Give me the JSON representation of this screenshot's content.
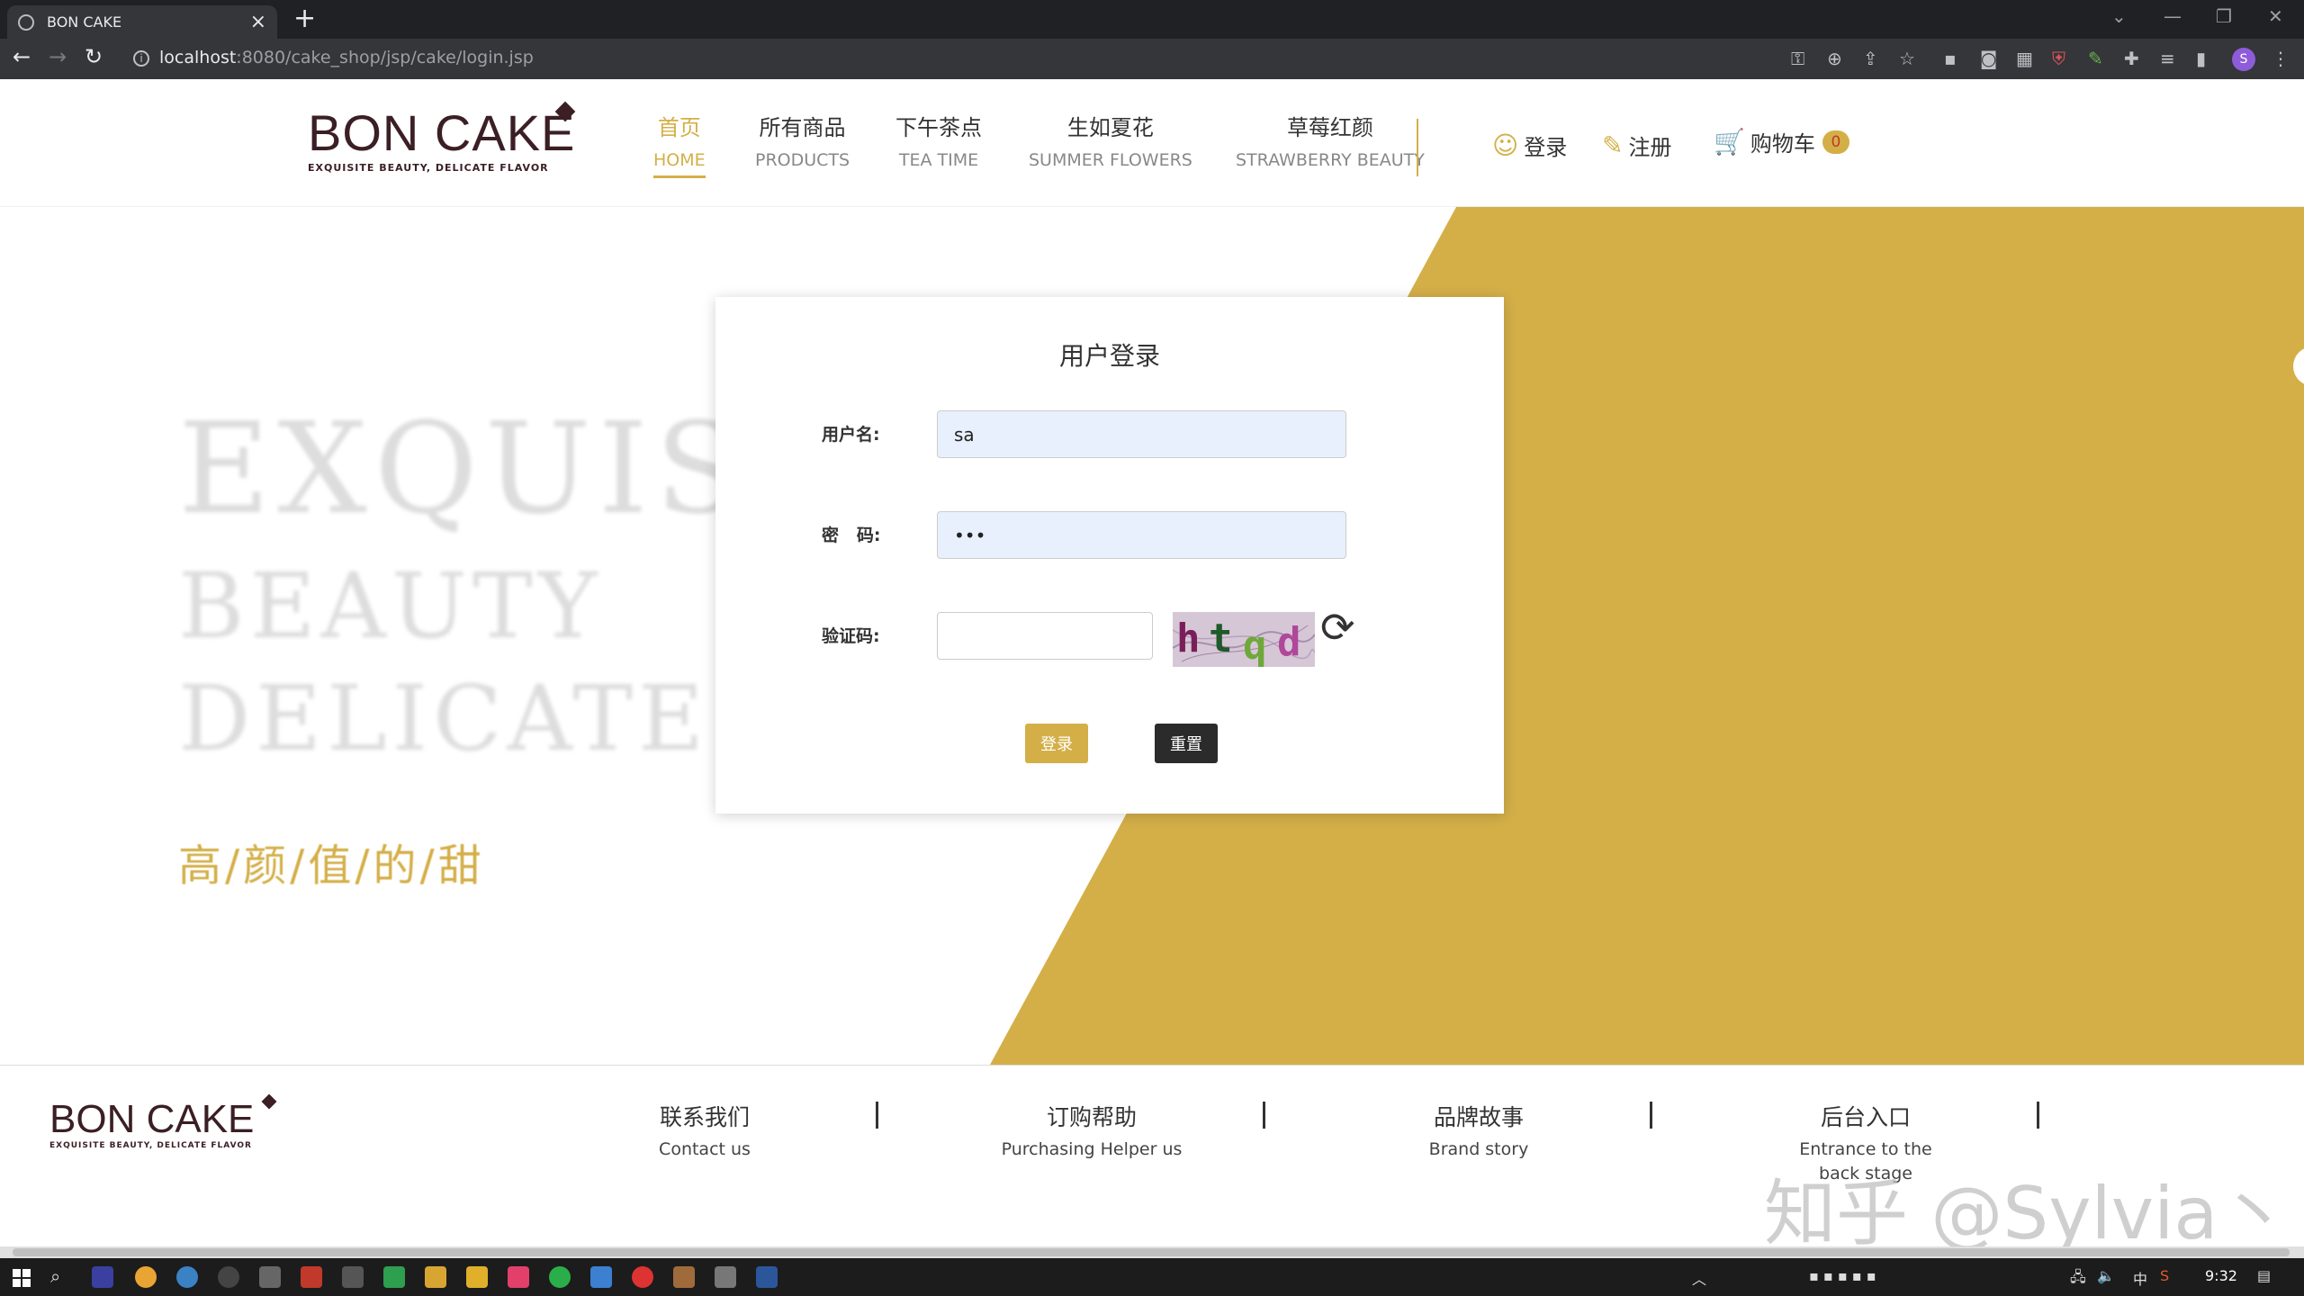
{
  "browser": {
    "tab_title": "BON CAKE",
    "tab_close": "×",
    "new_tab": "+",
    "url_host": "localhost",
    "url_path": ":8080/cake_shop/jsp/cake/login.jsp",
    "profile_initial": "S",
    "win_minimize": "—",
    "win_restore": "❐",
    "win_close": "✕",
    "win_tabsearch": "⌄"
  },
  "site": {
    "logo_text": "BON CAKE",
    "logo_tagline": "EXQUISITE BEAUTY, DELICATE FLAVOR",
    "menu": [
      {
        "cn": "首页",
        "en": "HOME"
      },
      {
        "cn": "所有商品",
        "en": "PRODUCTS"
      },
      {
        "cn": "下午茶点",
        "en": "TEA TIME"
      },
      {
        "cn": "生如夏花",
        "en": "SUMMER FLOWERS"
      },
      {
        "cn": "草莓红颜",
        "en": "STRAWBERRY BEAUTY"
      }
    ],
    "login_link": "登录",
    "register_link": "注册",
    "cart_link": "购物车",
    "cart_count": "0"
  },
  "hero": {
    "line1": "EXQUISITE",
    "line2": "BEAUTY",
    "line3": "DELICATE FLAVOR",
    "slogan": "高/颜/值/的/甜",
    "gold_color": "#d4af48"
  },
  "login": {
    "title": "用户登录",
    "username_label": "用户名:",
    "username_value": "sa",
    "password_label": "密   码:",
    "password_value": "•••",
    "captcha_label": "验证码:",
    "captcha_value": "",
    "captcha_text": [
      "h",
      "t",
      "q",
      "d"
    ],
    "login_button": "登录",
    "reset_button": "重置"
  },
  "footer": {
    "logo_text": "BON CAKE",
    "logo_tagline": "EXQUISITE BEAUTY, DELICATE FLAVOR",
    "columns": [
      {
        "cn": "联系我们",
        "en": "Contact us"
      },
      {
        "cn": "订购帮助",
        "en": "Purchasing Helper us"
      },
      {
        "cn": "品牌故事",
        "en": "Brand story"
      },
      {
        "cn": "后台入口",
        "en": "Entrance to the back stage"
      }
    ],
    "watermark": "知乎 @Sylvia丶"
  },
  "taskbar": {
    "time": "9:32",
    "ime": "中"
  }
}
